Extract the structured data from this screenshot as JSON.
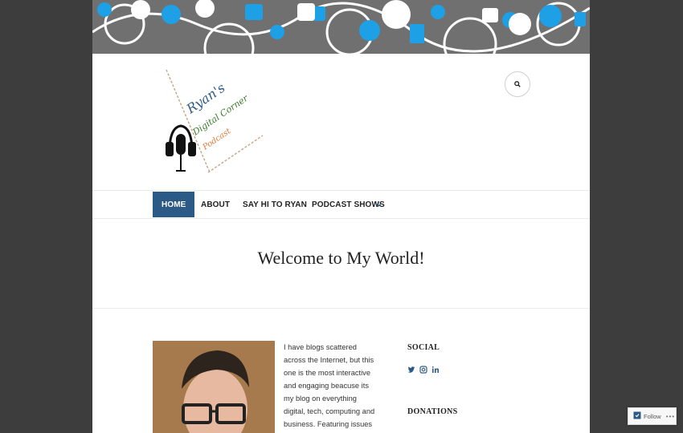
{
  "header": {
    "search_icon": "search-icon"
  },
  "logo": {
    "line1": "RYAN'S",
    "line2": "DIGITAL CORNER",
    "line3": "PODCAST"
  },
  "nav": {
    "items": [
      {
        "label": "HOME",
        "active": true
      },
      {
        "label": "ABOUT",
        "active": false
      },
      {
        "label": "SAY HI TO RYAN",
        "active": false
      },
      {
        "label": "PODCAST SHOWS",
        "active": false
      }
    ],
    "dropdown_icon": "chevron-down-icon"
  },
  "hero": {
    "title": "Welcome to My World!"
  },
  "intro": {
    "text": "I have blogs scattered across the Internet, but this one is the most interactive and engaging beacuse its my blog on everything digital, tech, computing and business. Featuring issues related to the"
  },
  "sidebar": {
    "social_title": "SOCIAL",
    "social_icons": [
      "twitter-icon",
      "instagram-icon",
      "linkedin-icon"
    ],
    "donations_title": "DONATIONS"
  },
  "follow": {
    "label": "Follow",
    "more": "•••"
  },
  "colors": {
    "accent": "#2c5a86",
    "banner_bg": "#6e6e6e",
    "banner_blue": "#1ea0e6",
    "page_bg": "#3d3d3d"
  }
}
